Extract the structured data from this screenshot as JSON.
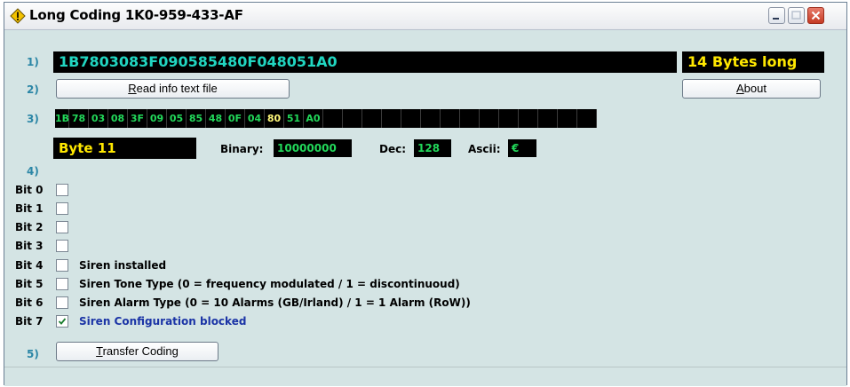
{
  "window": {
    "title": "Long Coding 1K0-959-433-AF"
  },
  "steps": {
    "s1": "1)",
    "s2": "2)",
    "s3": "3)",
    "s4": "4)",
    "s5": "5)"
  },
  "coding": {
    "value": "1B7803083F090585480F048051A0",
    "length_label": "14 Bytes long"
  },
  "buttons": {
    "read_info_prefix": "",
    "read_info_ul": "R",
    "read_info_rest": "ead info text file",
    "about_ul": "A",
    "about_rest": "bout",
    "transfer_ul": "T",
    "transfer_rest": "ransfer Coding"
  },
  "bytes": [
    "1B",
    "78",
    "03",
    "08",
    "3F",
    "09",
    "05",
    "85",
    "48",
    "0F",
    "04",
    "80",
    "51",
    "A0",
    "",
    "",
    "",
    "",
    "",
    "",
    "",
    "",
    "",
    "",
    "",
    "",
    "",
    ""
  ],
  "selected_byte_index": 11,
  "selected": {
    "byte_label": "Byte 11",
    "binary_label": "Binary:",
    "binary_value": "10000000",
    "dec_label": "Dec:",
    "dec_value": "128",
    "ascii_label": "Ascii:",
    "ascii_value": "€"
  },
  "bits": [
    {
      "label": "Bit 0",
      "checked": false,
      "desc": ""
    },
    {
      "label": "Bit 1",
      "checked": false,
      "desc": ""
    },
    {
      "label": "Bit 2",
      "checked": false,
      "desc": ""
    },
    {
      "label": "Bit 3",
      "checked": false,
      "desc": ""
    },
    {
      "label": "Bit 4",
      "checked": false,
      "desc": "Siren installed"
    },
    {
      "label": "Bit 5",
      "checked": false,
      "desc": "Siren Tone Type (0 = frequency modulated / 1 = discontinuoud)"
    },
    {
      "label": "Bit 6",
      "checked": false,
      "desc": "Siren Alarm Type (0 = 10 Alarms (GB/Irland) / 1 = 1 Alarm (RoW))"
    },
    {
      "label": "Bit 7",
      "checked": true,
      "desc": "Siren Configuration blocked"
    }
  ],
  "icons": {
    "app": "warning-diamond-icon",
    "minimize": "minimize-icon",
    "maximize": "maximize-icon",
    "close": "close-icon",
    "check": "checkmark-icon"
  },
  "colors": {
    "background": "#d4e4e4",
    "display_black": "#000000",
    "cyan_text": "#21d6c1",
    "yellow_text": "#ffe800",
    "green_text": "#22d85a",
    "step_number": "#2b86a6",
    "checked_desc": "#1b34a6"
  }
}
